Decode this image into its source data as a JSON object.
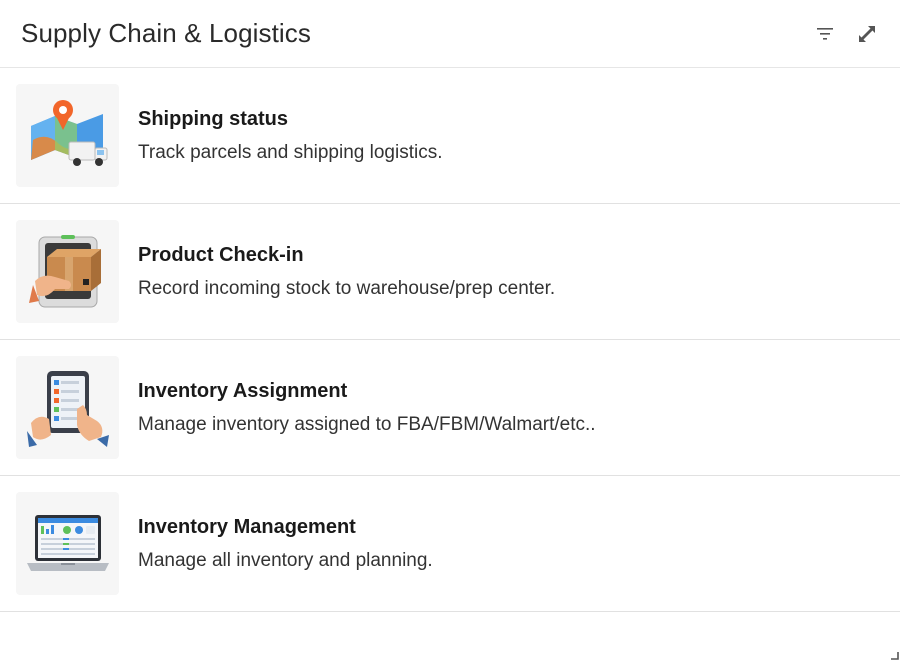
{
  "header": {
    "title": "Supply Chain & Logistics",
    "filter_icon": "filter-icon",
    "expand_icon": "expand-icon"
  },
  "items": [
    {
      "title": "Shipping status",
      "description": "Track parcels and shipping logistics.",
      "icon": "map-truck-icon"
    },
    {
      "title": "Product Check-in",
      "description": "Record incoming stock to warehouse/prep center.",
      "icon": "box-scanner-icon"
    },
    {
      "title": "Inventory Assignment",
      "description": "Manage inventory assigned to FBA/FBM/Walmart/etc..",
      "icon": "tablet-hands-icon"
    },
    {
      "title": "Inventory Management",
      "description": "Manage all inventory and planning.",
      "icon": "laptop-dashboard-icon"
    }
  ],
  "colors": {
    "accent_blue": "#3b8be0",
    "pin_orange": "#f2662a",
    "box_brown": "#c98a4e",
    "divider": "#e1e1e1"
  }
}
